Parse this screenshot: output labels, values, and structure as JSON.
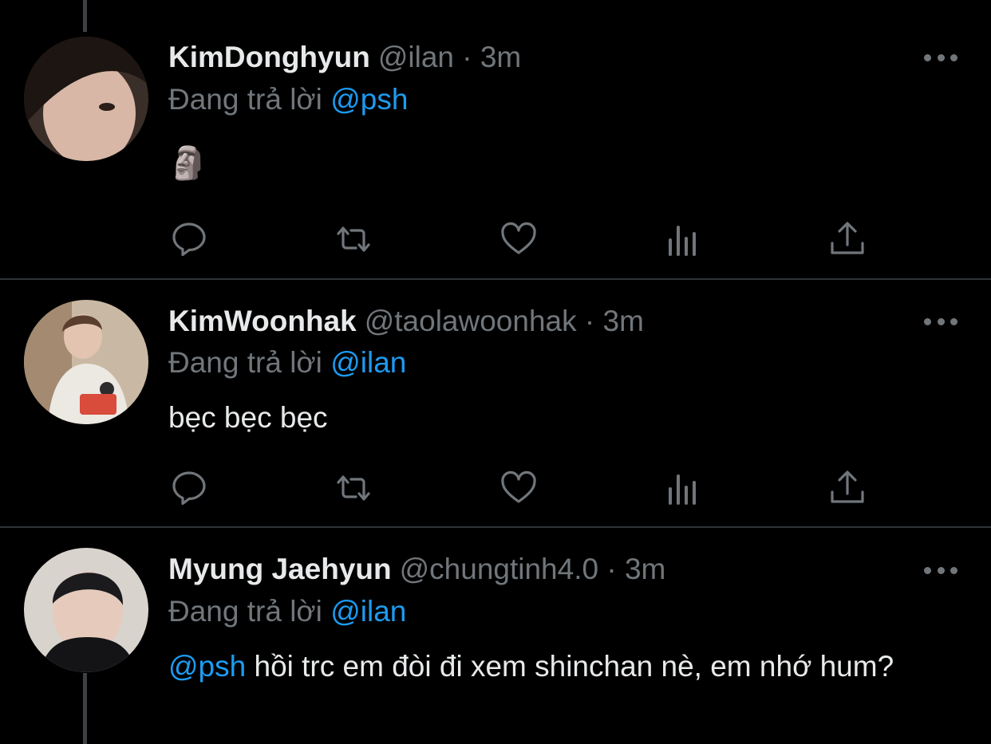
{
  "tweets": [
    {
      "name": "KimDonghyun",
      "handle": "@ilan",
      "time": "3m",
      "replying_prefix": "Đang trả lời",
      "replying_to": "@psh",
      "body_emoji": "🗿"
    },
    {
      "name": "KimWoonhak",
      "handle": "@taolawoonhak",
      "time": "3m",
      "replying_prefix": "Đang trả lời",
      "replying_to": "@ilan",
      "body": "bẹc bẹc bẹc"
    },
    {
      "name": "Myung Jaehyun",
      "handle": "@chungtinh4.0",
      "time": "3m",
      "replying_prefix": "Đang trả lời",
      "replying_to": "@ilan",
      "body_mention": "@psh",
      "body": "hồi trc em đòi đi xem shinchan nè, em nhớ hum?"
    }
  ],
  "separator": "·",
  "colors": {
    "background": "#000000",
    "text": "#e7e9ea",
    "muted": "#71767b",
    "accent": "#1d9bf0",
    "divider": "#2f3336"
  },
  "icons": [
    "reply-icon",
    "retweet-icon",
    "like-icon",
    "analytics-icon",
    "share-icon",
    "more-icon"
  ]
}
